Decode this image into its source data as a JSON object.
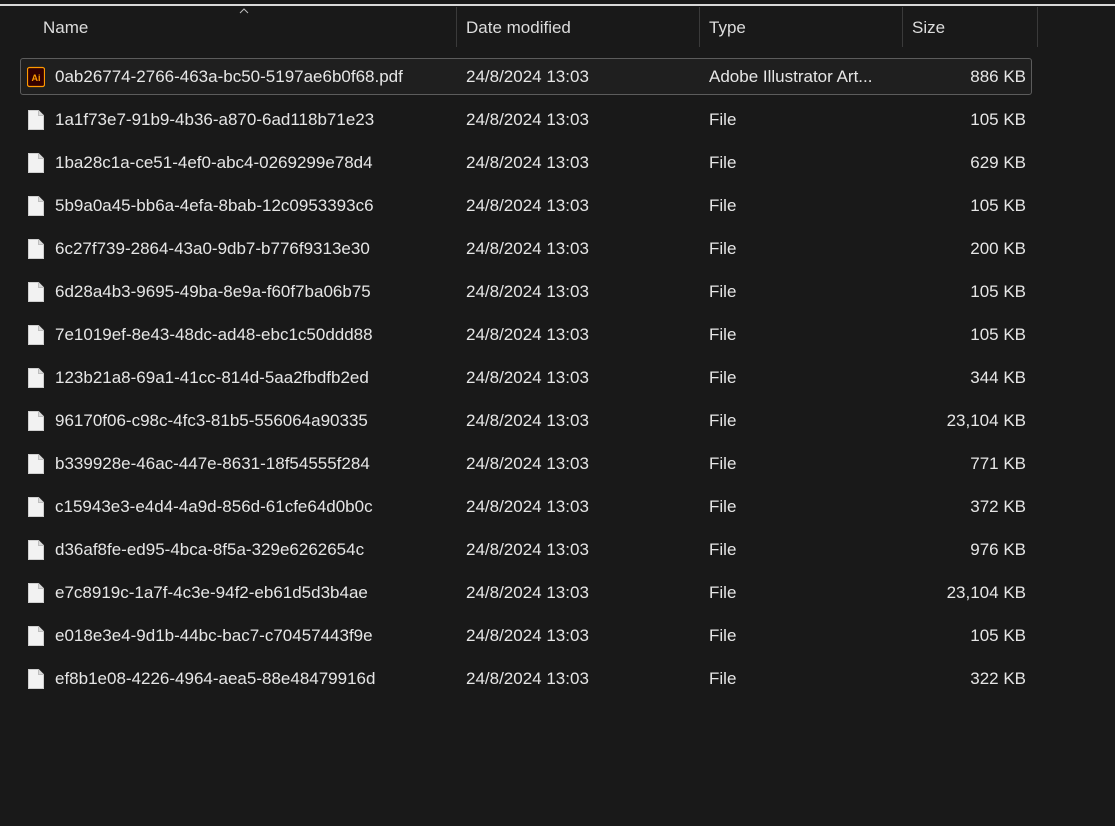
{
  "columns": {
    "name": "Name",
    "date_modified": "Date modified",
    "type": "Type",
    "size": "Size"
  },
  "sort": {
    "column": "name",
    "direction": "ascending",
    "indicator": "chevron-up-icon"
  },
  "colors": {
    "background": "#191919",
    "text": "#e6e6e6",
    "ai_icon_bg": "#330000",
    "ai_icon_accent": "#ff9a00"
  },
  "files": [
    {
      "name": "0ab26774-2766-463a-bc50-5197ae6b0f68.pdf",
      "date": "24/8/2024 13:03",
      "type": "Adobe Illustrator Art...",
      "size": "886 KB",
      "icon": "adobe-illustrator-icon",
      "selected": true
    },
    {
      "name": "1a1f73e7-91b9-4b36-a870-6ad118b71e23",
      "date": "24/8/2024 13:03",
      "type": "File",
      "size": "105 KB",
      "icon": "file-icon"
    },
    {
      "name": "1ba28c1a-ce51-4ef0-abc4-0269299e78d4",
      "date": "24/8/2024 13:03",
      "type": "File",
      "size": "629 KB",
      "icon": "file-icon"
    },
    {
      "name": "5b9a0a45-bb6a-4efa-8bab-12c0953393c6",
      "date": "24/8/2024 13:03",
      "type": "File",
      "size": "105 KB",
      "icon": "file-icon"
    },
    {
      "name": "6c27f739-2864-43a0-9db7-b776f9313e30",
      "date": "24/8/2024 13:03",
      "type": "File",
      "size": "200 KB",
      "icon": "file-icon"
    },
    {
      "name": "6d28a4b3-9695-49ba-8e9a-f60f7ba06b75",
      "date": "24/8/2024 13:03",
      "type": "File",
      "size": "105 KB",
      "icon": "file-icon"
    },
    {
      "name": "7e1019ef-8e43-48dc-ad48-ebc1c50ddd88",
      "date": "24/8/2024 13:03",
      "type": "File",
      "size": "105 KB",
      "icon": "file-icon"
    },
    {
      "name": "123b21a8-69a1-41cc-814d-5aa2fbdfb2ed",
      "date": "24/8/2024 13:03",
      "type": "File",
      "size": "344 KB",
      "icon": "file-icon"
    },
    {
      "name": "96170f06-c98c-4fc3-81b5-556064a90335",
      "date": "24/8/2024 13:03",
      "type": "File",
      "size": "23,104 KB",
      "icon": "file-icon"
    },
    {
      "name": "b339928e-46ac-447e-8631-18f54555f284",
      "date": "24/8/2024 13:03",
      "type": "File",
      "size": "771 KB",
      "icon": "file-icon"
    },
    {
      "name": "c15943e3-e4d4-4a9d-856d-61cfe64d0b0c",
      "date": "24/8/2024 13:03",
      "type": "File",
      "size": "372 KB",
      "icon": "file-icon"
    },
    {
      "name": "d36af8fe-ed95-4bca-8f5a-329e6262654c",
      "date": "24/8/2024 13:03",
      "type": "File",
      "size": "976 KB",
      "icon": "file-icon"
    },
    {
      "name": "e7c8919c-1a7f-4c3e-94f2-eb61d5d3b4ae",
      "date": "24/8/2024 13:03",
      "type": "File",
      "size": "23,104 KB",
      "icon": "file-icon"
    },
    {
      "name": "e018e3e4-9d1b-44bc-bac7-c70457443f9e",
      "date": "24/8/2024 13:03",
      "type": "File",
      "size": "105 KB",
      "icon": "file-icon"
    },
    {
      "name": "ef8b1e08-4226-4964-aea5-88e48479916d",
      "date": "24/8/2024 13:03",
      "type": "File",
      "size": "322 KB",
      "icon": "file-icon"
    }
  ]
}
